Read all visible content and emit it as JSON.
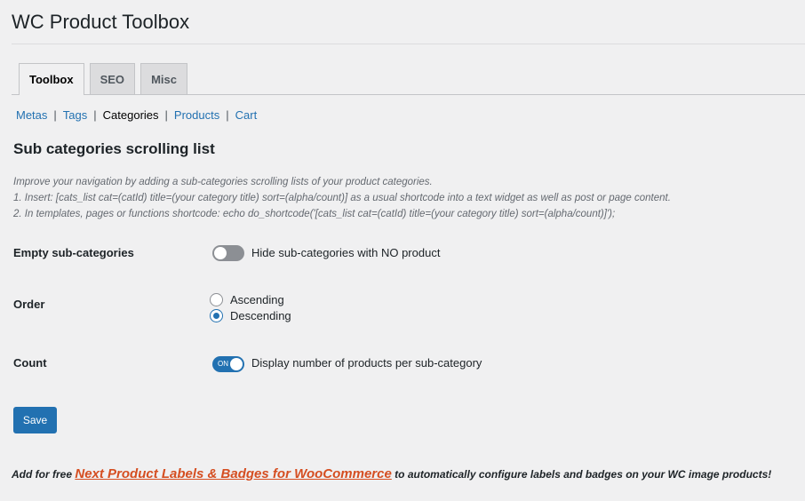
{
  "page": {
    "title": "WC Product Toolbox"
  },
  "tabs": [
    {
      "label": "Toolbox",
      "active": true
    },
    {
      "label": "SEO",
      "active": false
    },
    {
      "label": "Misc",
      "active": false
    }
  ],
  "subnav": {
    "items": [
      {
        "label": "Metas",
        "current": false
      },
      {
        "label": "Tags",
        "current": false
      },
      {
        "label": "Categories",
        "current": true
      },
      {
        "label": "Products",
        "current": false
      },
      {
        "label": "Cart",
        "current": false
      }
    ],
    "separator": "|"
  },
  "section": {
    "title": "Sub categories scrolling list",
    "description": [
      "Improve your navigation by adding a sub-categories scrolling lists of your product categories.",
      "1. Insert: [cats_list cat=(catId) title=(your category title) sort=(alpha/count)] as a usual shortcode into a text widget as well as post or page content.",
      "2. In templates, pages or functions shortcode: echo do_shortcode('[cats_list cat=(catId) title=(your category title) sort=(alpha/count)]');"
    ]
  },
  "settings": {
    "empty_subcategories": {
      "label": "Empty sub-categories",
      "toggle_state": "off",
      "description": "Hide sub-categories with NO product"
    },
    "order": {
      "label": "Order",
      "options": [
        {
          "label": "Ascending",
          "checked": false
        },
        {
          "label": "Descending",
          "checked": true
        }
      ]
    },
    "count": {
      "label": "Count",
      "toggle_state": "on",
      "toggle_text": "ON",
      "description": "Display number of products per sub-category"
    }
  },
  "actions": {
    "save_label": "Save"
  },
  "promo": {
    "prefix": "Add for free",
    "link_text": "Next Product Labels & Badges for WooCommerce",
    "suffix": "to automatically configure labels and badges on your WC image products!"
  },
  "colors": {
    "accent": "#2271b1",
    "promo_link": "#d54e21",
    "background": "#f0f0f1"
  }
}
